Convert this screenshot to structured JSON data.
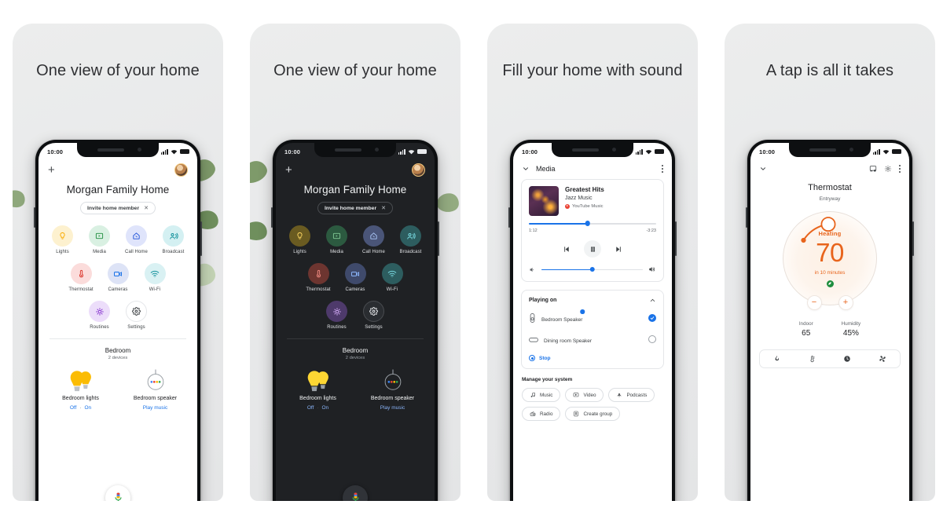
{
  "panels": [
    {
      "headline": "One view of your home",
      "theme": "light"
    },
    {
      "headline": "One view of your home",
      "theme": "dark"
    },
    {
      "headline": "Fill your home with sound",
      "theme": "light"
    },
    {
      "headline": "A tap is all it takes",
      "theme": "light"
    }
  ],
  "status_bar": {
    "time": "10:00"
  },
  "home": {
    "add_label": "+",
    "title": "Morgan Family Home",
    "invite_chip": {
      "label": "Invite home member",
      "close": "✕"
    },
    "shortcuts": [
      {
        "label": "Lights",
        "icon": "lightbulb-icon",
        "bubble": "#fdf1cf",
        "tint": "#f9ab00"
      },
      {
        "label": "Media",
        "icon": "media-play-icon",
        "bubble": "#d9f0e2",
        "tint": "#1e8e3e"
      },
      {
        "label": "Call Home",
        "icon": "call-home-icon",
        "bubble": "#dfe4fb",
        "tint": "#1a4ed8"
      },
      {
        "label": "Broadcast",
        "icon": "broadcast-icon",
        "bubble": "#d4f0f2",
        "tint": "#12919b"
      },
      {
        "label": "Thermostat",
        "icon": "thermometer-icon",
        "bubble": "#fbdcdb",
        "tint": "#d93025"
      },
      {
        "label": "Cameras",
        "icon": "camera-icon",
        "bubble": "#dde3f6",
        "tint": "#1a73e8"
      },
      {
        "label": "Wi-Fi",
        "icon": "wifi-icon",
        "bubble": "#d9f1f3",
        "tint": "#12919b"
      },
      {
        "label": "Routines",
        "icon": "routines-icon",
        "bubble": "#ecddfa",
        "tint": "#8430ce"
      },
      {
        "label": "Settings",
        "icon": "gear-icon",
        "bubble": "#ffffff",
        "tint": "#3c4043"
      }
    ],
    "room": {
      "name": "Bedroom",
      "device_count": "2 devices"
    },
    "devices": [
      {
        "name": "Bedroom lights",
        "icon": "two-bulbs-icon",
        "actions": [
          "Off",
          "·",
          "On"
        ]
      },
      {
        "name": "Bedroom speaker",
        "icon": "speaker-icon",
        "actions": [
          "Play music"
        ]
      }
    ],
    "assistant_button": "mic-icon",
    "nav": [
      {
        "icon": "home-icon",
        "name": "nav-home"
      },
      {
        "icon": "feed-icon",
        "name": "nav-feed"
      }
    ]
  },
  "media": {
    "header": {
      "title": "Media",
      "back_icon": "chevron-down-icon",
      "more_icon": "kebab-menu-icon"
    },
    "now_playing": {
      "track": "Greatest Hits",
      "artist": "Jazz Music",
      "source": "YouTube Music",
      "elapsed": "1:12",
      "remaining": "-3:23",
      "progress_percent": 46,
      "volume_percent": 50,
      "controls": {
        "previous": "previous-track-icon",
        "pause": "pause-icon",
        "next": "next-track-icon"
      }
    },
    "playing_on": {
      "title": "Playing on",
      "collapse_icon": "chevron-up-icon",
      "speakers": [
        {
          "name": "Bedroom Speaker",
          "icon": "speaker-tall-icon",
          "selected": true,
          "volume_percent": 56
        },
        {
          "name": "Dining room Speaker",
          "icon": "speaker-wide-icon",
          "selected": false,
          "volume_percent": 0
        }
      ],
      "stop_label": "Stop"
    },
    "manage": {
      "title": "Manage your system",
      "chips": [
        {
          "label": "Music",
          "icon": "music-note-icon"
        },
        {
          "label": "Video",
          "icon": "video-screen-icon"
        },
        {
          "label": "Podcasts",
          "icon": "podcast-icon"
        },
        {
          "label": "Radio",
          "icon": "radio-icon"
        },
        {
          "label": "Create group",
          "icon": "create-group-icon"
        }
      ]
    }
  },
  "thermostat": {
    "header": {
      "back_icon": "chevron-down-icon",
      "cast_icon": "cast-icon",
      "settings_icon": "gear-icon",
      "more_icon": "kebab-menu-icon"
    },
    "title": "Thermostat",
    "location": "Entryway",
    "dial": {
      "mode": "Heating",
      "temperature": "70",
      "eta": "in 10 minutes",
      "eco_badge": "leaf-icon",
      "accent": "#e8641c",
      "decrease": "−",
      "increase": "+"
    },
    "readings": [
      {
        "label": "Indoor",
        "value": "65"
      },
      {
        "label": "Humidity",
        "value": "45%"
      }
    ],
    "modes": [
      {
        "icon": "flame-icon",
        "name": "mode-heat"
      },
      {
        "icon": "thermometer-icon",
        "name": "mode-temperature"
      },
      {
        "icon": "clock-icon",
        "name": "mode-schedule"
      },
      {
        "icon": "fan-icon",
        "name": "mode-fan"
      }
    ]
  },
  "colors": {
    "page_background": "#ffffff",
    "panel_background": "#eaebec",
    "blue": "#1a73e8",
    "orange": "#e8641c",
    "yellow": "#f9ab00"
  }
}
